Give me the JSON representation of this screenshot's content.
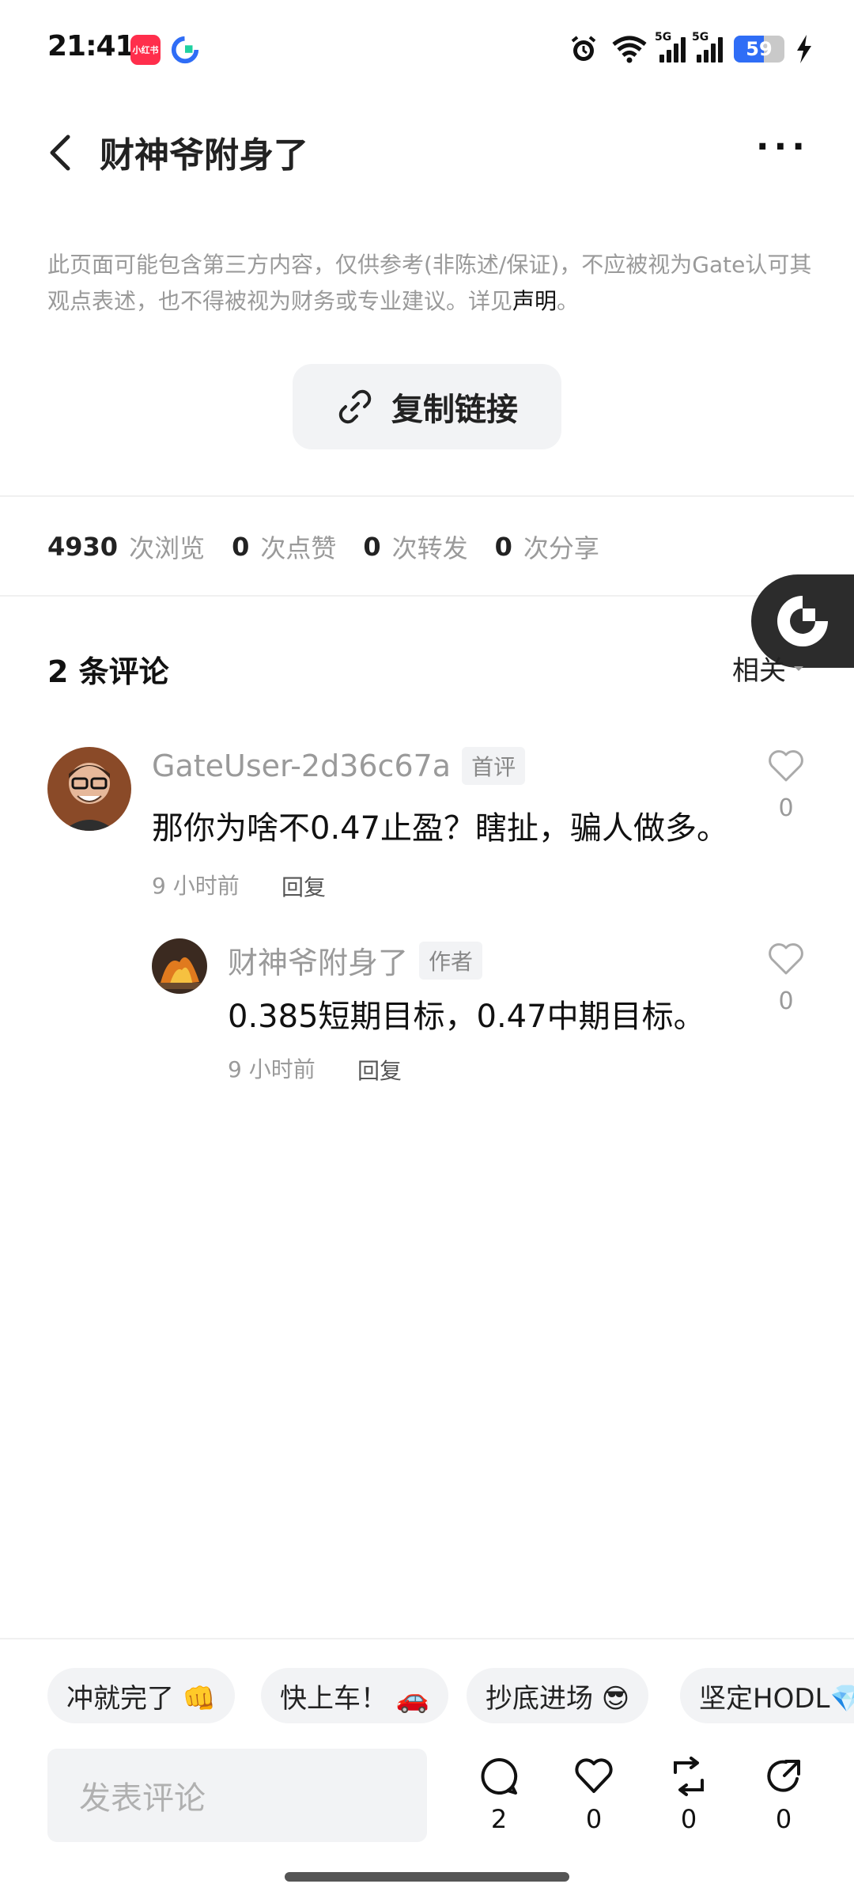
{
  "status_bar": {
    "time": "21:41",
    "app_badge": "小红书",
    "network_1": "5G",
    "network_2": "5G",
    "battery": "59",
    "battery_level": 0.59
  },
  "header": {
    "title": "财神爷附身了",
    "more_label": "···"
  },
  "disclaimer": {
    "text_main": "此页面可能包含第三方内容，仅供参考(非陈述/保证)，不应被视为Gate认可其观点表述，也不得被视为财务或专业建议。详见",
    "link": "声明",
    "end": "。"
  },
  "copy_link_label": "复制链接",
  "stats": {
    "views": "4930",
    "views_label": "次浏览",
    "likes": "0",
    "likes_label": "次点赞",
    "reposts": "0",
    "reposts_label": "次转发",
    "shares": "0",
    "shares_label": "次分享"
  },
  "comments": {
    "title": "2 条评论",
    "sort_label": "相关",
    "items": [
      {
        "user": "GateUser-2d36c67a",
        "tag": "首评",
        "text": "那你为啥不0.47止盈？瞎扯，骗人做多。",
        "time": "9 小时前",
        "reply": "回复",
        "likes": "0"
      },
      {
        "user": "财神爷附身了",
        "tag": "作者",
        "text": "0.385短期目标，0.47中期目标。",
        "time": "9 小时前",
        "reply": "回复",
        "likes": "0"
      }
    ]
  },
  "quick_replies": [
    "冲就完了 👊",
    "快上车！ 🚗",
    "抄底进场 😎",
    "坚定HODL💎"
  ],
  "composer": {
    "placeholder": "发表评论"
  },
  "actions": {
    "comments": "2",
    "likes": "0",
    "reposts": "0",
    "shares": "0"
  },
  "colors": {
    "accent_blue": "#2f6df6",
    "badge_red": "#ff2e4c",
    "floating_tab": "#2c2c2c"
  }
}
